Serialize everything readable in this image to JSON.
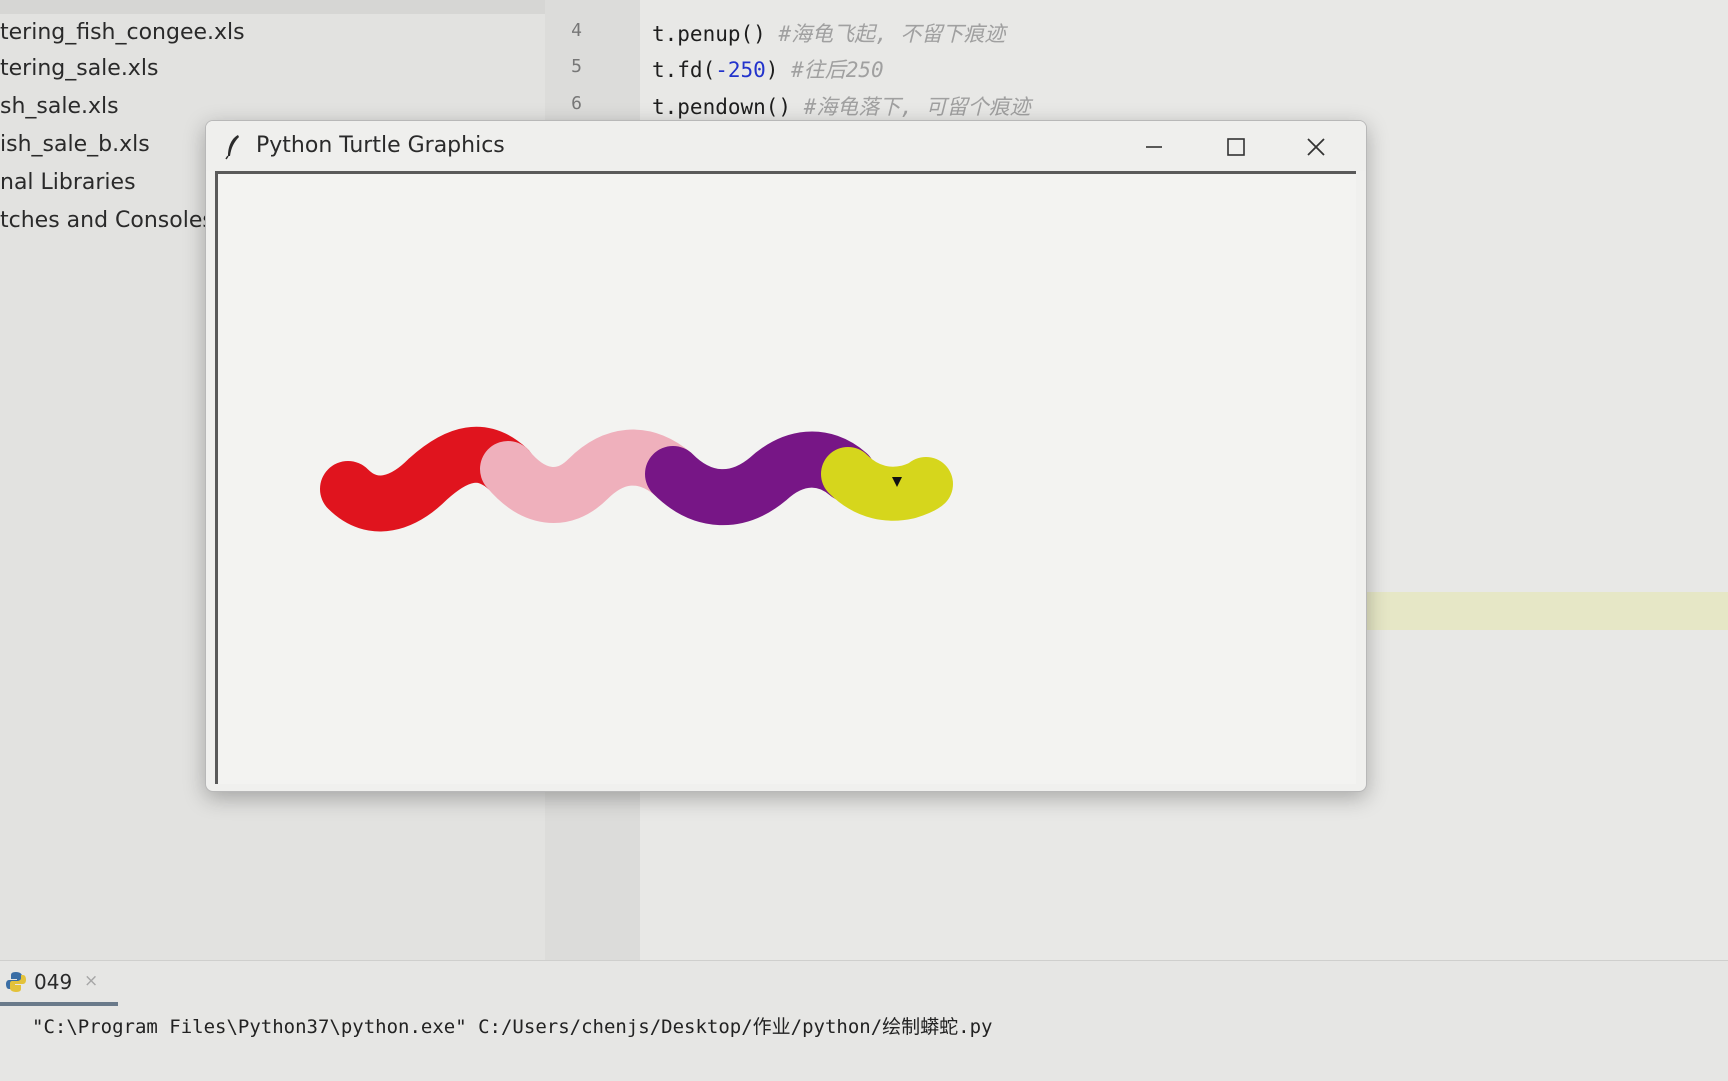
{
  "project_tree": {
    "items": [
      "tering_fish_congee.xls",
      "tering_sale.xls",
      "sh_sale.xls",
      "ish_sale_b.xls",
      "nal Libraries",
      "tches and Consoles"
    ]
  },
  "editor": {
    "lines": [
      {
        "no": "4",
        "code": "t.penup()",
        "comment": "#海龟飞起, 不留下痕迹"
      },
      {
        "no": "5",
        "code_pre": "t.fd(",
        "code_num": "-250",
        "code_post": ")",
        "comment": "#往后250"
      },
      {
        "no": "6",
        "code": "t.pendown()",
        "comment": "#海龟落下, 可留个痕迹"
      }
    ]
  },
  "turtle_window": {
    "title": "Python Turtle Graphics",
    "snake_colors": [
      "#e0141e",
      "#efb0bc",
      "#771686",
      "#d6d61c"
    ],
    "turtle_color": "#111111"
  },
  "run_panel": {
    "tab_name": "049",
    "close_glyph": "×",
    "command": "\"C:\\Program Files\\Python37\\python.exe\" C:/Users/chenjs/Desktop/作业/python/绘制蟒蛇.py"
  }
}
